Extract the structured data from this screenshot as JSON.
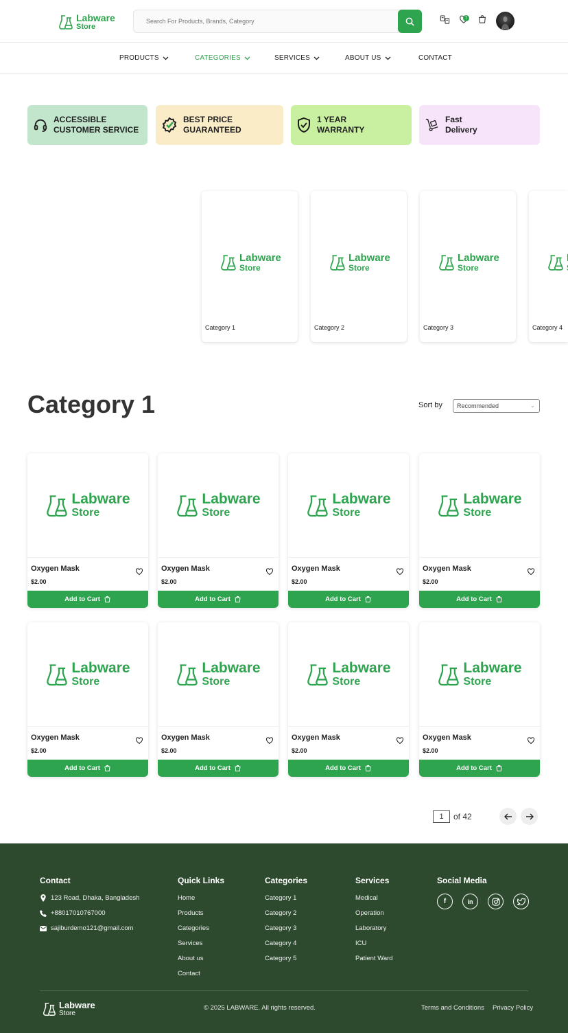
{
  "brand": {
    "line1": "Labware",
    "line2": "Store",
    "color": "#2ea44f"
  },
  "header": {
    "search_placeholder": "Search For Products, Brands, Category",
    "wishlist_count": "7"
  },
  "nav": [
    {
      "label": "PRODUCTS",
      "active": false
    },
    {
      "label": "CATEGORIES",
      "active": true
    },
    {
      "label": "SERVICES",
      "active": false
    },
    {
      "label": "ABOUT US",
      "active": false
    },
    {
      "label": "CONTACT",
      "active": false
    }
  ],
  "features": [
    {
      "line1": "ACCESSIBLE",
      "line2": "CUSTOMER SERVICE",
      "bg": "#c1e6cb",
      "icon": "headset-icon"
    },
    {
      "line1": "BEST PRICE",
      "line2": "GUARANTEED",
      "bg": "#fbecc8",
      "icon": "badge-check-icon"
    },
    {
      "line1": "1 YEAR",
      "line2": "WARRANTY",
      "bg": "#c9f0a0",
      "icon": "shield-check-icon"
    },
    {
      "line1": "Fast",
      "line2": "Delivery",
      "bg": "#f7e4fb",
      "icon": "hand-truck-icon"
    }
  ],
  "categories": [
    "Category 1",
    "Category 2",
    "Category 3",
    "Category 4"
  ],
  "listing": {
    "title": "Category 1",
    "sort_label": "Sort by",
    "sort_value": "Recommended"
  },
  "products": [
    {
      "name": "Oxygen Mask",
      "price": "$2.00",
      "cta": "Add to Cart"
    },
    {
      "name": "Oxygen Mask",
      "price": "$2.00",
      "cta": "Add to Cart"
    },
    {
      "name": "Oxygen Mask",
      "price": "$2.00",
      "cta": "Add to Cart"
    },
    {
      "name": "Oxygen Mask",
      "price": "$2.00",
      "cta": "Add to Cart"
    },
    {
      "name": "Oxygen Mask",
      "price": "$2.00",
      "cta": "Add to Cart"
    },
    {
      "name": "Oxygen Mask",
      "price": "$2.00",
      "cta": "Add to Cart"
    },
    {
      "name": "Oxygen Mask",
      "price": "$2.00",
      "cta": "Add to Cart"
    },
    {
      "name": "Oxygen Mask",
      "price": "$2.00",
      "cta": "Add to Cart"
    }
  ],
  "pagination": {
    "current": "1",
    "of_text": "of 42"
  },
  "footer": {
    "contact": {
      "title": "Contact",
      "address": "123 Road, Dhaka, Bangladesh",
      "phone": "+88017010767000",
      "email": "sajiburdemo121@gmail.com"
    },
    "quick_links": {
      "title": "Quick Links",
      "items": [
        "Home",
        "Products",
        "Categories",
        "Services",
        "About us",
        "Contact"
      ]
    },
    "categories": {
      "title": "Categories",
      "items": [
        "Category 1",
        "Category 2",
        "Category 3",
        "Category 4",
        "Category 5"
      ]
    },
    "services": {
      "title": "Services",
      "items": [
        "Medical",
        "Operation",
        "Laboratory",
        "ICU",
        "Patient Ward"
      ]
    },
    "social": {
      "title": "Social Media",
      "items": [
        "facebook-icon",
        "linkedin-icon",
        "instagram-icon",
        "twitter-icon"
      ]
    },
    "copyright": "© 2025 LABWARE. All rights reserved.",
    "terms": "Terms and Conditions",
    "privacy": "Privacy Policy",
    "bg": "#2d4a2f"
  }
}
